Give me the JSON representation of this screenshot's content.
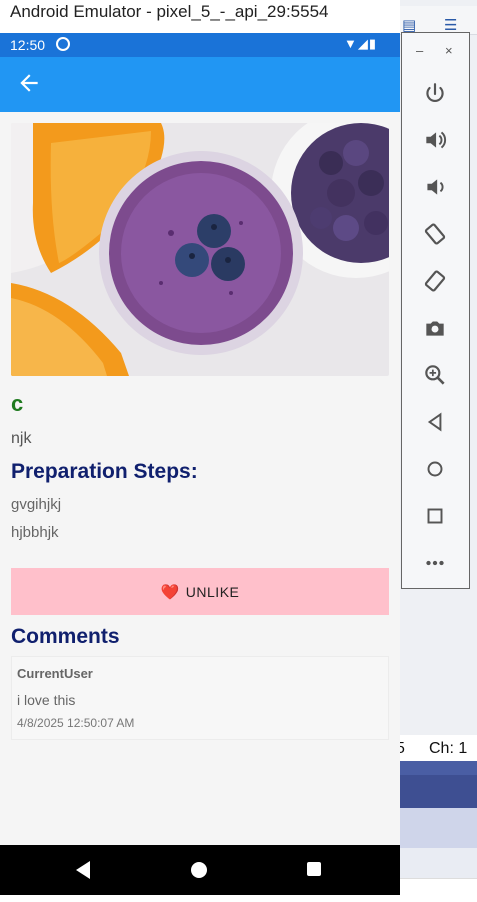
{
  "window": {
    "title": "Android Emulator - pixel_5_-_api_29:5554"
  },
  "status_bar": {
    "time": "12:50",
    "icons": "▼◢▮"
  },
  "recipe": {
    "title": "c",
    "description": "njk",
    "steps_heading": "Preparation Steps:",
    "steps": [
      "gvgihjkj",
      "hjbbhjk"
    ]
  },
  "like_button": {
    "icon": "❤️",
    "label": "UNLIKE"
  },
  "comments": {
    "heading": "Comments",
    "items": [
      {
        "user": "CurrentUser",
        "text": "i love this",
        "date": "4/8/2025 12:50:07 AM"
      }
    ]
  },
  "side_panel": {
    "window_controls": {
      "minimize": "–",
      "close": "×"
    },
    "more": "•••"
  },
  "background_ide": {
    "col_text": "5",
    "ch_label": "Ch: 1"
  },
  "colors": {
    "app_bar": "#2196f3",
    "status_bar": "#1a73d8",
    "title_green": "#1f7a1f",
    "heading_navy": "#10206e",
    "unlike_button": "#ffc0cb"
  }
}
